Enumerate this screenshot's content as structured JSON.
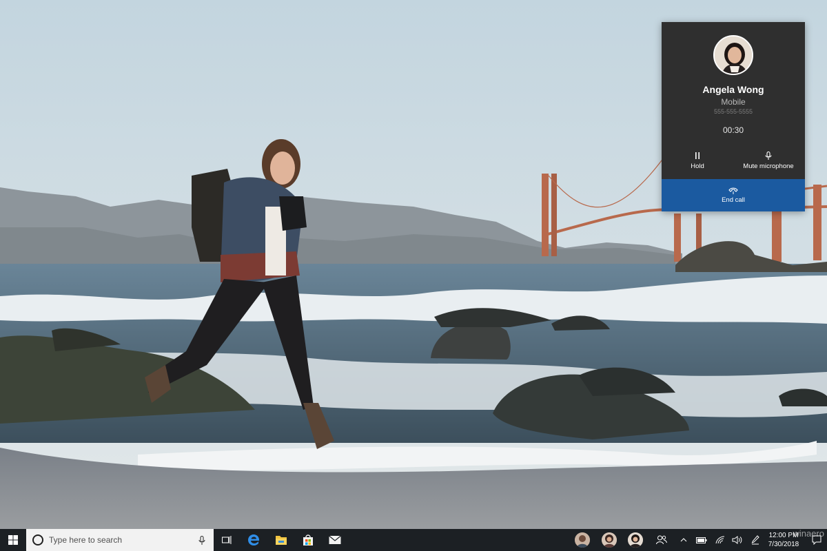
{
  "call_toast": {
    "caller_name": "Angela Wong",
    "caller_type": "Mobile",
    "caller_number": "555-555-5555",
    "timer": "00:30",
    "hold_label": "Hold",
    "mute_label": "Mute microphone",
    "end_call_label": "End call",
    "colors": {
      "background": "#2f2f2f",
      "end_call": "#1b5aa0"
    }
  },
  "taskbar": {
    "search_placeholder": "Type here to search",
    "apps": [
      "task-view-icon",
      "edge-icon",
      "file-explorer-icon",
      "store-icon",
      "mail-icon"
    ],
    "people_contacts": 3,
    "clock_time": "12:00 PM",
    "clock_date": "7/30/2018",
    "background": "#1c2024"
  },
  "wallpaper": {
    "icon": "beach-golden-gate-photo"
  },
  "watermark": "winaero"
}
